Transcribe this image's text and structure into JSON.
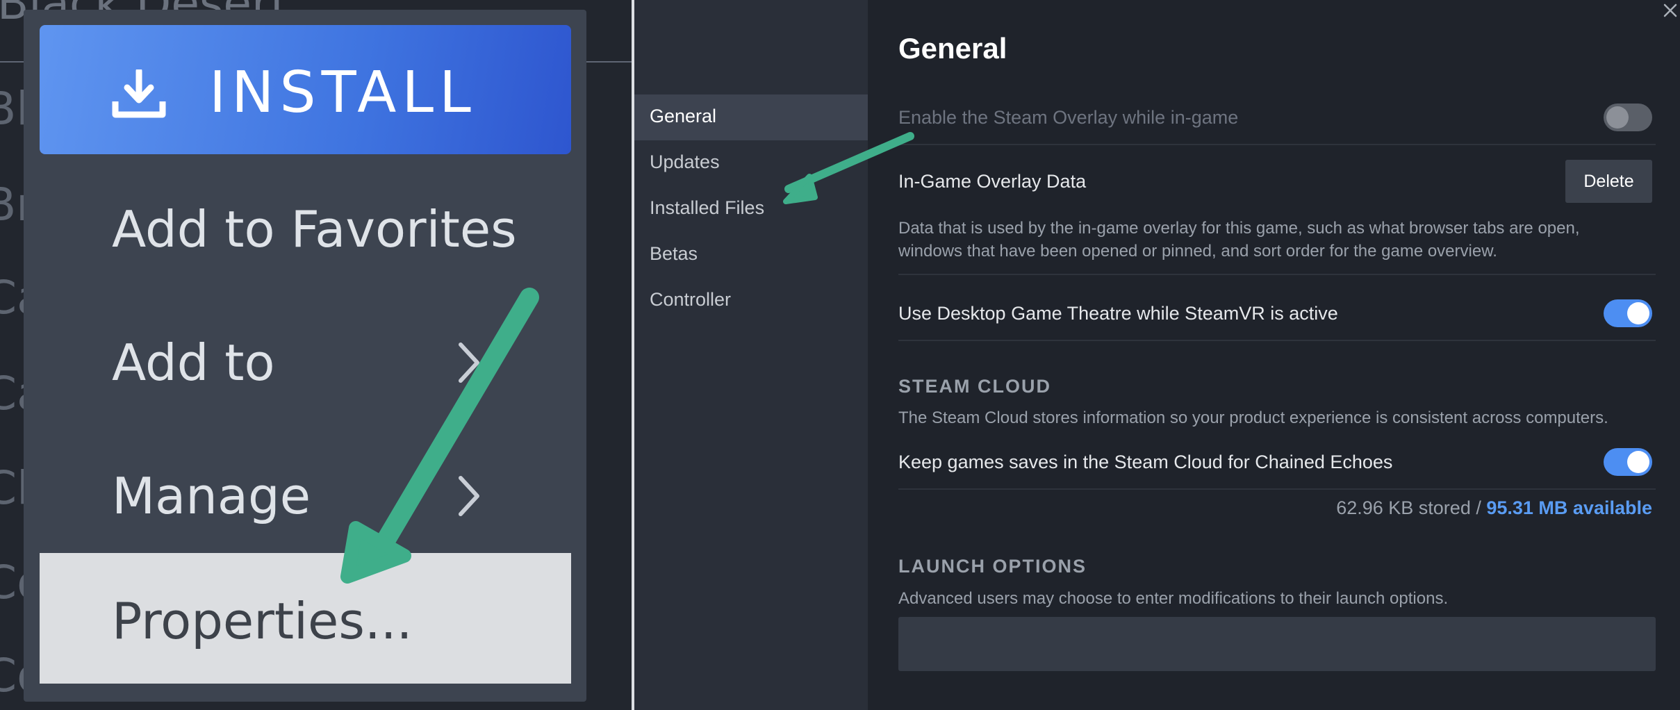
{
  "left": {
    "background_title": "Black Desert",
    "background_letters": [
      "Bl",
      "Br",
      "Ca",
      "Ca",
      "Cl",
      "Co",
      "Co"
    ],
    "menu": {
      "install_label": "INSTALL",
      "items": [
        {
          "label": "Add to Favorites",
          "has_submenu": false
        },
        {
          "label": "Add to",
          "has_submenu": true
        },
        {
          "label": "Manage",
          "has_submenu": true
        },
        {
          "label": "Properties...",
          "has_submenu": false
        }
      ]
    }
  },
  "sidebar": {
    "items": [
      {
        "label": "General",
        "active": true
      },
      {
        "label": "Updates",
        "active": false
      },
      {
        "label": "Installed Files",
        "active": false
      },
      {
        "label": "Betas",
        "active": false
      },
      {
        "label": "Controller",
        "active": false
      }
    ]
  },
  "content": {
    "title": "General",
    "overlay_setting": {
      "label": "Enable the Steam Overlay while in-game",
      "enabled": false
    },
    "overlay_data": {
      "label": "In-Game Overlay Data",
      "button": "Delete",
      "description": "Data that is used by the in-game overlay for this game, such as what browser tabs are open, windows that have been opened or pinned, and sort order for the game overview."
    },
    "theatre_setting": {
      "label": "Use Desktop Game Theatre while SteamVR is active",
      "enabled": true
    },
    "steam_cloud": {
      "heading": "STEAM CLOUD",
      "description": "The Steam Cloud stores information so your product experience is consistent across computers.",
      "setting_label": "Keep games saves in the Steam Cloud for Chained Echoes",
      "enabled": true,
      "stored": "62.96 KB stored /",
      "available": "95.31 MB available"
    },
    "launch_options": {
      "heading": "LAUNCH OPTIONS",
      "description": "Advanced users may choose to enter modifications to their launch options.",
      "value": ""
    }
  },
  "colors": {
    "accent_blue": "#4d8ef2",
    "install_gradient_start": "#5f95f0",
    "install_gradient_end": "#2e56cf",
    "annotation_arrow": "#3fae8a"
  },
  "icons": [
    "download-icon",
    "chevron-right-icon",
    "close-icon",
    "annotation-arrow"
  ]
}
